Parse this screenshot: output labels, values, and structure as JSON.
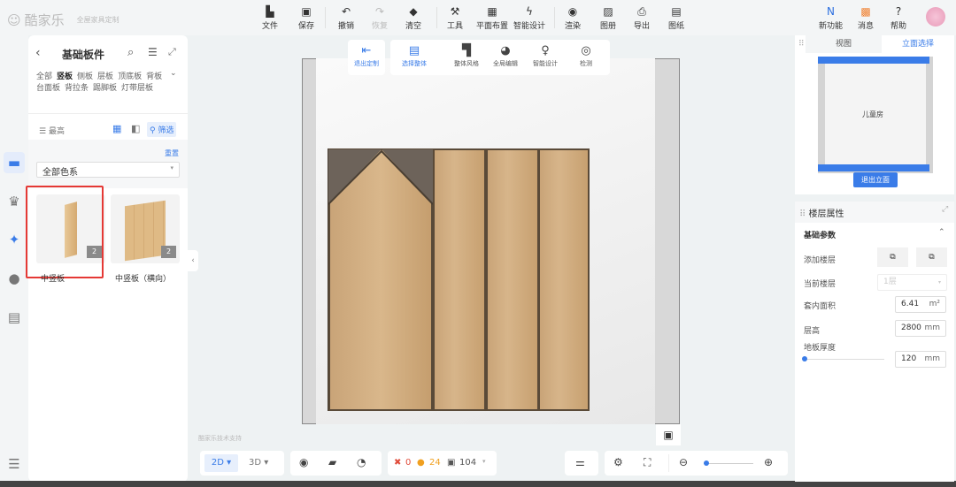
{
  "brand": {
    "name": "酷家乐",
    "tagline": "全屋家具定制"
  },
  "toolbar": [
    {
      "label": "文件",
      "icon": "file-icon"
    },
    {
      "label": "保存",
      "icon": "save-icon"
    },
    {
      "label": "撤销",
      "icon": "undo-icon"
    },
    {
      "label": "恢复",
      "icon": "redo-icon"
    },
    {
      "label": "清空",
      "icon": "eraser-icon"
    },
    {
      "label": "工具",
      "icon": "wrench-icon"
    },
    {
      "label": "平面布置",
      "icon": "layout-icon"
    },
    {
      "label": "智能设计",
      "icon": "lightning-icon"
    },
    {
      "label": "渲染",
      "icon": "camera-icon"
    },
    {
      "label": "图册",
      "icon": "album-icon"
    },
    {
      "label": "导出",
      "icon": "export-icon"
    },
    {
      "label": "图纸",
      "icon": "drawing-icon"
    }
  ],
  "top_right": [
    {
      "label": "新功能",
      "icon": "new-feature-icon"
    },
    {
      "label": "消息",
      "icon": "gift-icon"
    },
    {
      "label": "帮助",
      "icon": "help-icon"
    }
  ],
  "left_panel": {
    "title": "基础板件",
    "categories": [
      "全部",
      "竖板",
      "侧板",
      "层板",
      "顶底板",
      "背板",
      "台面板",
      "背拉条",
      "踢脚板",
      "灯带层板"
    ],
    "active_category": "竖板",
    "sort_label": "最高",
    "filter_label": "筛选",
    "reset_label": "重置",
    "color_select": "全部色系",
    "items": [
      {
        "name": "中竖板",
        "count": "2"
      },
      {
        "name": "中竖板（横向）",
        "count": "2"
      }
    ]
  },
  "float_toolbar": {
    "exit": "退出定制",
    "tools": [
      "选择整体",
      "整体风格",
      "全局编辑",
      "智能设计",
      "检测"
    ]
  },
  "watermark": "酷家乐技术支持",
  "view_panel": {
    "tabs": [
      "视图",
      "立面选择"
    ],
    "active_tab": "立面选择",
    "room": "儿童房",
    "exit_button": "退出立面"
  },
  "props": {
    "title": "楼层属性",
    "section": "基础参数",
    "add_floor": "添加楼层",
    "current_floor_label": "当前楼层",
    "current_floor": "1层",
    "area_label": "套内面积",
    "area": "6.41",
    "area_unit": "m²",
    "height_label": "层高",
    "height": "2800",
    "height_unit": "mm",
    "thickness_label": "地板厚度",
    "thickness": "120",
    "thickness_unit": "mm",
    "thickness_slider": 0
  },
  "bottom": {
    "mode_2d": "2D",
    "mode_3d": "3D",
    "errors": "0",
    "warnings": "24",
    "items": "104",
    "zoom_level": 0.05
  },
  "colors": {
    "accent": "#3a7ce8",
    "selection": "#e53935"
  }
}
